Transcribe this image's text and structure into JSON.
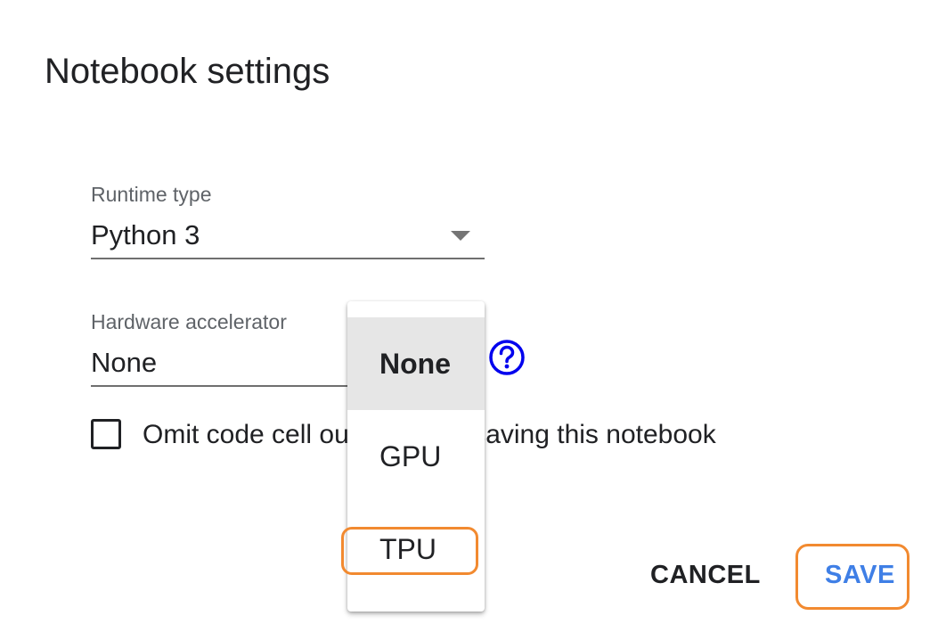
{
  "dialog": {
    "title": "Notebook settings"
  },
  "runtime_type": {
    "label": "Runtime type",
    "value": "Python 3"
  },
  "hardware_accelerator": {
    "label": "Hardware accelerator",
    "value": "None",
    "options": [
      {
        "label": "None",
        "selected": true
      },
      {
        "label": "GPU",
        "selected": false
      },
      {
        "label": "TPU",
        "selected": false
      }
    ]
  },
  "omit_output": {
    "label": "Omit code cell output when saving this notebook",
    "checked": false
  },
  "buttons": {
    "cancel_label": "CANCEL",
    "save_label": "SAVE"
  },
  "icons": {
    "help": "help-circle-icon",
    "dropdown": "dropdown-arrow-icon"
  },
  "colors": {
    "primary": "#3f7fe6",
    "highlight": "#f28a30",
    "help_icon": "#0000ee",
    "selected_option_bg": "#e6e6e6"
  }
}
